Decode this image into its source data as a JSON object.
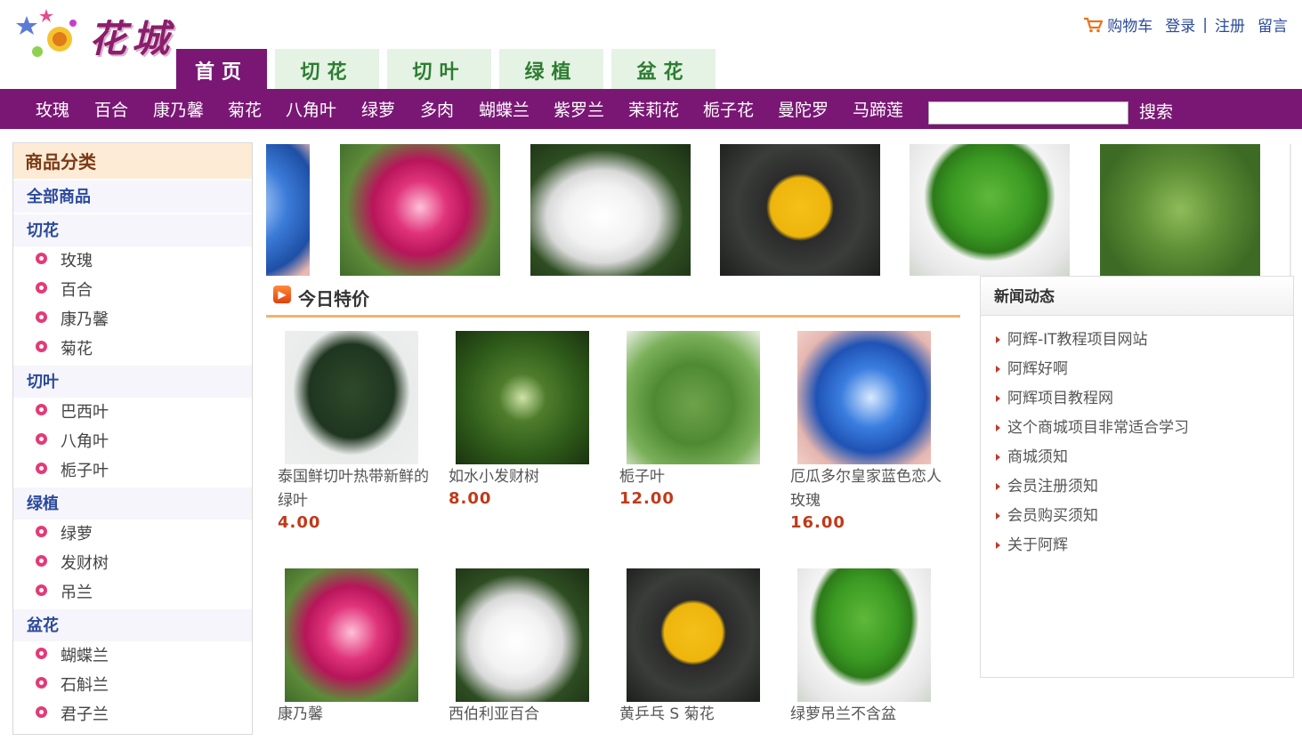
{
  "brand": {
    "title": "花城"
  },
  "toplinks": {
    "cart": "购物车",
    "login": "登录",
    "sep": "|",
    "register": "注册",
    "message": "留言"
  },
  "tabs": [
    "首页",
    "切花",
    "切叶",
    "绿植",
    "盆花"
  ],
  "nav": [
    "玫瑰",
    "百合",
    "康乃馨",
    "菊花",
    "八角叶",
    "绿萝",
    "多肉",
    "蝴蝶兰",
    "紫罗兰",
    "茉莉花",
    "栀子花",
    "曼陀罗",
    "马蹄莲"
  ],
  "search": {
    "value": "",
    "button": "搜索"
  },
  "sidebar": {
    "title": "商品分类",
    "all": "全部商品",
    "groups": [
      {
        "name": "切花",
        "items": [
          "玫瑰",
          "百合",
          "康乃馨",
          "菊花"
        ]
      },
      {
        "name": "切叶",
        "items": [
          "巴西叶",
          "八角叶",
          "栀子叶"
        ]
      },
      {
        "name": "绿植",
        "items": [
          "绿萝",
          "发财树",
          "吊兰"
        ]
      },
      {
        "name": "盆花",
        "items": [
          "蝴蝶兰",
          "石斛兰",
          "君子兰"
        ]
      }
    ]
  },
  "special": {
    "title": "今日特价",
    "products": [
      {
        "name": "泰国鲜切叶热带新鲜的绿叶",
        "price": "4.00"
      },
      {
        "name": "如水小发财树",
        "price": "8.00"
      },
      {
        "name": "栀子叶",
        "price": "12.00"
      },
      {
        "name": "厄瓜多尔皇家蓝色恋人玫瑰",
        "price": "16.00"
      },
      {
        "name": "康乃馨",
        "price": ""
      },
      {
        "name": "西伯利亚百合",
        "price": ""
      },
      {
        "name": "黄乒乓 S 菊花",
        "price": ""
      },
      {
        "name": "绿萝吊兰不含盆",
        "price": ""
      }
    ]
  },
  "news": {
    "title": "新闻动态",
    "items": [
      "阿辉-IT教程项目网站",
      "阿辉好啊",
      "阿辉项目教程网",
      "这个商城项目非常适合学习",
      "商城须知",
      "会员注册须知",
      "会员购买须知",
      "关于阿辉"
    ]
  },
  "colors": {
    "brand_purple": "#7a1775",
    "tab_green": "#e4f3e4",
    "price_red": "#c03a1a",
    "link_blue": "#2b4a9c"
  }
}
